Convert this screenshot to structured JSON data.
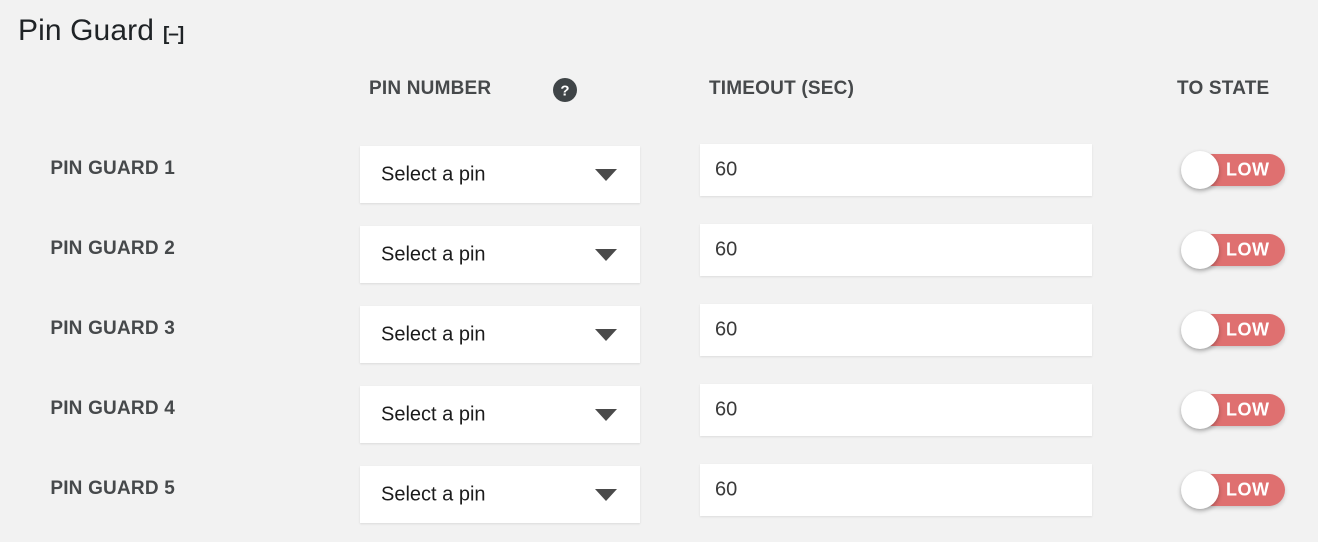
{
  "panel": {
    "title": "Pin Guard",
    "collapse_toggle": "[–]"
  },
  "headers": {
    "pin_number": "PIN NUMBER",
    "pin_number_help_icon": "help-circle-icon",
    "timeout": "TIMEOUT (SEC)",
    "to_state": "TO STATE"
  },
  "colors": {
    "background": "#f2f2f2",
    "toggle_on": "#df7070",
    "text": "#46494b",
    "title": "#1f2326"
  },
  "rows": [
    {
      "label": "PIN GUARD 1",
      "pin_placeholder": "Select a pin",
      "timeout": "60",
      "to_state": "LOW"
    },
    {
      "label": "PIN GUARD 2",
      "pin_placeholder": "Select a pin",
      "timeout": "60",
      "to_state": "LOW"
    },
    {
      "label": "PIN GUARD 3",
      "pin_placeholder": "Select a pin",
      "timeout": "60",
      "to_state": "LOW"
    },
    {
      "label": "PIN GUARD 4",
      "pin_placeholder": "Select a pin",
      "timeout": "60",
      "to_state": "LOW"
    },
    {
      "label": "PIN GUARD 5",
      "pin_placeholder": "Select a pin",
      "timeout": "60",
      "to_state": "LOW"
    }
  ]
}
